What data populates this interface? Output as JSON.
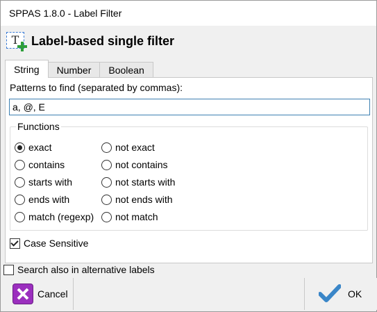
{
  "window": {
    "title": "SPPAS 1.8.0  - Label Filter"
  },
  "header": {
    "title": "Label-based single filter",
    "icon": "text-label-add-icon"
  },
  "tabs": [
    {
      "label": "String",
      "active": true
    },
    {
      "label": "Number",
      "active": false
    },
    {
      "label": "Boolean",
      "active": false
    }
  ],
  "string_tab": {
    "patterns_label": "Patterns to find (separated by commas):",
    "patterns_value": "a, @, E",
    "functions_label": "Functions",
    "functions": [
      {
        "label": "exact",
        "selected": true
      },
      {
        "label": "not exact",
        "selected": false
      },
      {
        "label": "contains",
        "selected": false
      },
      {
        "label": "not contains",
        "selected": false
      },
      {
        "label": "starts with",
        "selected": false
      },
      {
        "label": "not starts with",
        "selected": false
      },
      {
        "label": "ends with",
        "selected": false
      },
      {
        "label": "not ends with",
        "selected": false
      },
      {
        "label": "match (regexp)",
        "selected": false
      },
      {
        "label": "not match",
        "selected": false
      }
    ],
    "case_sensitive_label": "Case Sensitive",
    "case_sensitive_checked": true
  },
  "alt_labels": {
    "label": "Search also in alternative labels",
    "checked": false
  },
  "buttons": {
    "cancel": "Cancel",
    "ok": "OK"
  },
  "colors": {
    "input_border": "#3c7fb1",
    "cancel_icon": "#9b2fbe",
    "ok_icon": "#3a86c8"
  }
}
